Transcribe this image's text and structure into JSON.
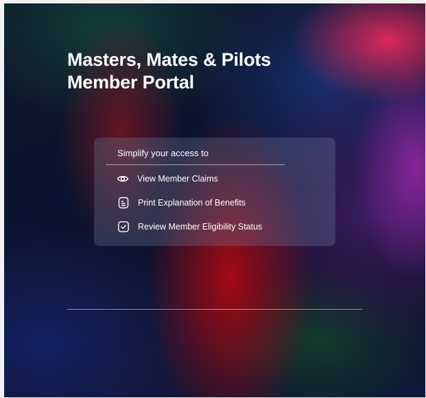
{
  "hero": {
    "title_line1": "Masters, Mates & Pilots",
    "title_line2": "Member Portal"
  },
  "card": {
    "heading": "Simplify your access to",
    "items": [
      {
        "label": "View Member Claims",
        "icon": "eye-icon"
      },
      {
        "label": "Print Explanation of Benefits",
        "icon": "document-icon"
      },
      {
        "label": "Review Member Eligibility Status",
        "icon": "check-square-icon"
      }
    ]
  },
  "colors": {
    "text": "#ffffff",
    "card_background": "rgba(120,140,175,0.28)",
    "accent_red": "#aa0a14",
    "accent_pink": "#e6285a",
    "base_navy": "#0b1430"
  }
}
